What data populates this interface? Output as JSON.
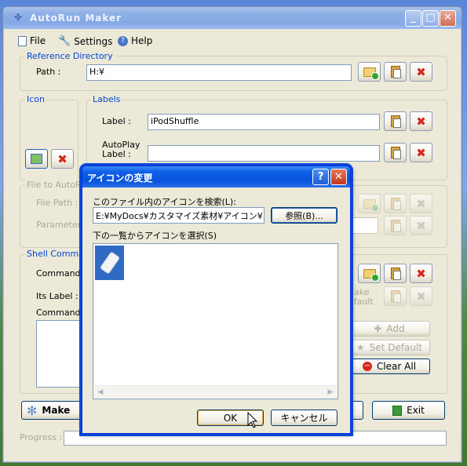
{
  "main_window": {
    "title": "AutoRun Maker",
    "menu": [
      {
        "label": "File",
        "icon": "document-icon"
      },
      {
        "label": "Settings",
        "icon": "wrench-icon"
      },
      {
        "label": "Help",
        "icon": "help-icon"
      }
    ],
    "reference_directory": {
      "title": "Reference Directory",
      "path_label": "Path :",
      "path_value": "H:¥"
    },
    "icon_group": {
      "title": "Icon"
    },
    "labels_group": {
      "title": "Labels",
      "label_label": "Label :",
      "label_value": "iPodShuffle",
      "autoplay_label_line1": "AutoPlay",
      "autoplay_label_line2": "Label :",
      "autoplay_value": ""
    },
    "file_to_autorun": {
      "title": "File to AutoRu",
      "file_path_label": "File Path :",
      "parameters_label": "Parameters"
    },
    "shell_command": {
      "title": "Shell Comman",
      "command_label": "Command :",
      "its_label_label": "Its Label :",
      "command_list_label": "Command L",
      "make_default_line1": "ake",
      "make_default_line2": "efault",
      "add_label": "Add",
      "set_default_label": "Set Default",
      "clear_all_label": "Clear All"
    },
    "make_label": "Make",
    "exit_label": "Exit",
    "progress_label": "Progress :"
  },
  "dialog": {
    "title": "アイコンの変更",
    "search_label": "このファイル内のアイコンを検索(L):",
    "file_path": "E:¥MyDocs¥カスタマイズ素材¥アイコン¥ハー",
    "browse_label": "参照(B)...",
    "list_label": "下の一覧からアイコンを選択(S)",
    "ok_label": "OK",
    "cancel_label": "キャンセル"
  },
  "colors": {
    "accent_blue": "#0046d5",
    "delete_red": "#d8261b",
    "dialog_title_blue": "#0854dc"
  }
}
